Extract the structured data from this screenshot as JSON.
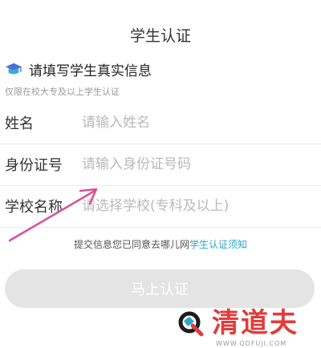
{
  "page": {
    "title": "学生认证"
  },
  "section": {
    "title": "请填写学生真实信息",
    "subtitle": "仅限在校大专及以上学生认证"
  },
  "form": {
    "name": {
      "label": "姓名",
      "placeholder": "请输入姓名"
    },
    "id_number": {
      "label": "身份证号",
      "placeholder": "请输入身份证号码"
    },
    "school": {
      "label": "学校名称",
      "placeholder": "请选择学校(专科及以上)"
    }
  },
  "agreement": {
    "prefix": "提交信息您已同意去哪儿网",
    "link": "学生认证须知"
  },
  "submit": {
    "label": "马上认证"
  },
  "watermark": {
    "brand": "清道夫",
    "url": "WWW.QDFUJI.COM"
  },
  "colors": {
    "link": "#2aa7c9",
    "button_disabled": "#e4e4e4",
    "arrow": "#d9509a",
    "watermark": "#e13b3b"
  },
  "icons": {
    "section": "graduation-cap-icon",
    "watermark": "q-logo-icon"
  }
}
